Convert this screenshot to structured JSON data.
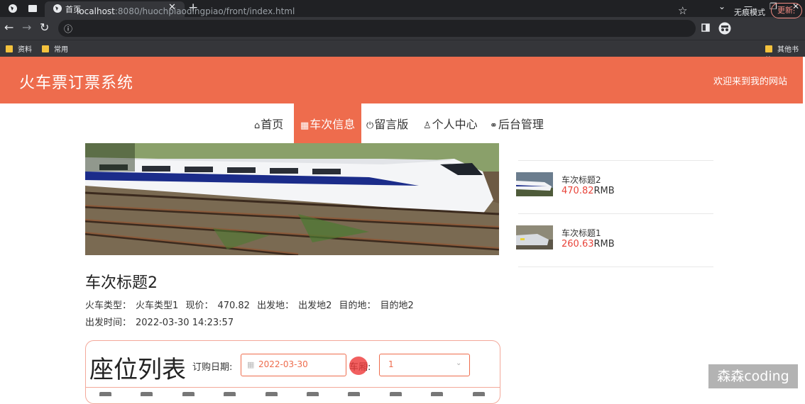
{
  "browser": {
    "tab_title": "首页",
    "url_host": "localhost",
    "url_rest": ":8080/huochpiaodingpiao/front/index.html",
    "incognito_label": "无痕模式",
    "update_label": "更新",
    "bookmarks": [
      "资料",
      "常用"
    ],
    "other_bookmarks": "其他书签"
  },
  "site": {
    "title": "火车票订票系统",
    "welcome": "欢迎来到我的网站"
  },
  "nav": [
    {
      "icon": "home-icon",
      "label": "首页"
    },
    {
      "icon": "calendar-icon",
      "label": "车次信息"
    },
    {
      "icon": "power-icon",
      "label": "留言版"
    },
    {
      "icon": "user-icon",
      "label": "个人中心"
    },
    {
      "icon": "link-icon",
      "label": "后台管理"
    }
  ],
  "train": {
    "title": "车次标题2",
    "type_label": "火车类型：",
    "type_value": "火车类型1",
    "price_label": "现价：",
    "price_value": "470.82",
    "from_label": "出发地：",
    "from_value": "出发地2",
    "to_label": "目的地：",
    "to_value": "目的地2",
    "depart_label": "出发时间：",
    "depart_value": "2022-03-30 14:23:57"
  },
  "seats": {
    "heading": "座位列表",
    "date_label": "订购日期:",
    "date_value": "2022-03-30",
    "car_label": "车厢:",
    "car_value": "1"
  },
  "sidebar": [
    {
      "name": "车次标题2",
      "price": "470.82",
      "unit": "RMB"
    },
    {
      "name": "车次标题1",
      "price": "260.63",
      "unit": "RMB"
    }
  ],
  "watermark": "森森coding"
}
